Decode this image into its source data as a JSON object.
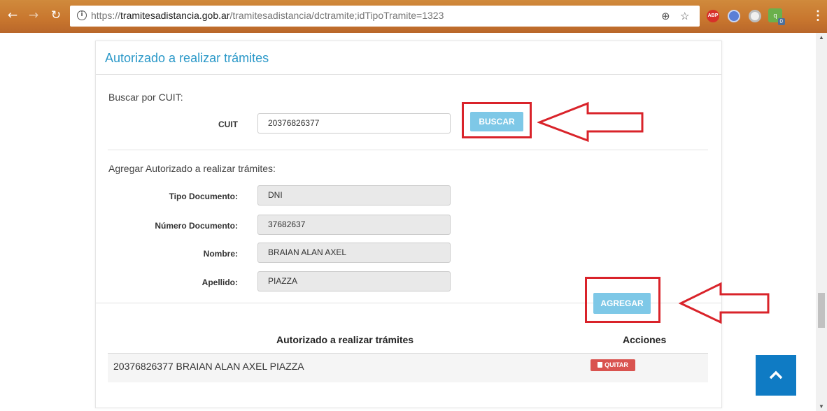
{
  "browser": {
    "url_prefix": "https://",
    "url_host": "tramitesadistancia.gob.ar",
    "url_path": "/tramitesadistancia/dctramite;idTipoTramite=1323",
    "abp_label": "ABP",
    "ext_badge": "0",
    "ext_letter": "q"
  },
  "panel": {
    "title": "Autorizado a realizar trámites"
  },
  "search": {
    "section_label": "Buscar por CUIT:",
    "cuit_label": "CUIT",
    "cuit_value": "20376826377",
    "button_label": "BUSCAR"
  },
  "add": {
    "section_label": "Agregar Autorizado a realizar trámites:",
    "fields": [
      {
        "label": "Tipo Documento:",
        "value": "DNI"
      },
      {
        "label": "Número Documento:",
        "value": "37682637"
      },
      {
        "label": "Nombre:",
        "value": "BRAIAN ALAN AXEL"
      },
      {
        "label": "Apellido:",
        "value": "PIAZZA"
      }
    ],
    "button_label": "AGREGAR"
  },
  "table": {
    "col_name": "Autorizado a realizar trámites",
    "col_actions": "Acciones",
    "rows": [
      {
        "text": "20376826377 BRAIAN ALAN AXEL PIAZZA",
        "action_label": "QUITAR"
      }
    ]
  },
  "colors": {
    "accent": "#2a98c8",
    "button": "#7ec8e7",
    "highlight": "#d9232a",
    "danger": "#d9534f",
    "scroll_top": "#0f7bc4"
  }
}
